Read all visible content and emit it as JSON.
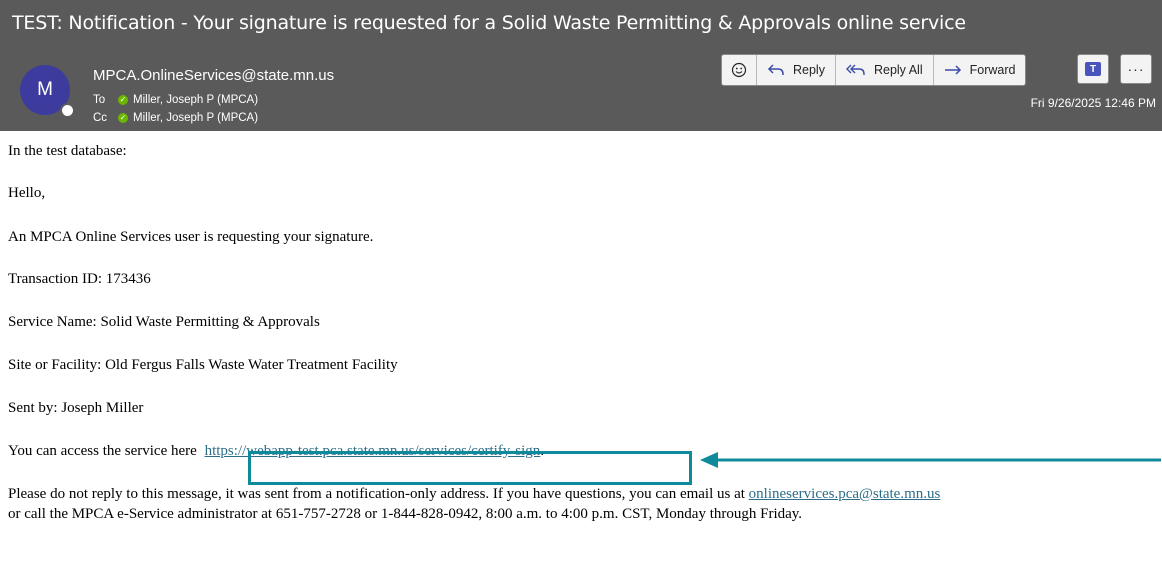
{
  "header": {
    "subject": "TEST: Notification - Your signature is requested for a Solid Waste Permitting & Approvals online service",
    "avatar_initial": "M",
    "sender": "MPCA.OnlineServices@state.mn.us",
    "to_label": "To",
    "to_value": "Miller, Joseph P (MPCA)",
    "cc_label": "Cc",
    "cc_value": "Miller, Joseph P (MPCA)",
    "date": "Fri 9/26/2025 12:46 PM"
  },
  "toolbar": {
    "emoji_icon": "smiley-icon",
    "reply_label": "Reply",
    "reply_all_label": "Reply All",
    "forward_label": "Forward",
    "teams_icon": "teams-icon",
    "more_label": "···"
  },
  "body": {
    "line1": "In the test database:",
    "line2": "Hello,",
    "line3": "An MPCA Online Services user is requesting your signature.",
    "line4": "Transaction ID: 173436",
    "line5": "Service Name: Solid Waste Permitting & Approvals",
    "line6": "Site or Facility: Old Fergus Falls Waste Water Treatment Facility",
    "line7": "Sent by: Joseph Miller",
    "line8_prefix": "You can access the service here",
    "line8_link": "https://webapp-test.pca.state.mn.us/services/certify-sign",
    "line8_suffix": ".",
    "line9_prefix": "Please do not reply to this message, it was sent from a notification-only address. If you have questions, you can email us at ",
    "line9_link": "onlineservices.pca@state.mn.us",
    "line10": "or call the MPCA e-Service administrator at 651-757-2728 or 1-844-828-0942, 8:00 a.m. to 4:00 p.m. CST, Monday through Friday."
  },
  "colors": {
    "header_bg": "#5a5a5a",
    "avatar_bg": "#3d3b9e",
    "highlight": "#0f8a9b",
    "link": "#2d6d8a"
  }
}
